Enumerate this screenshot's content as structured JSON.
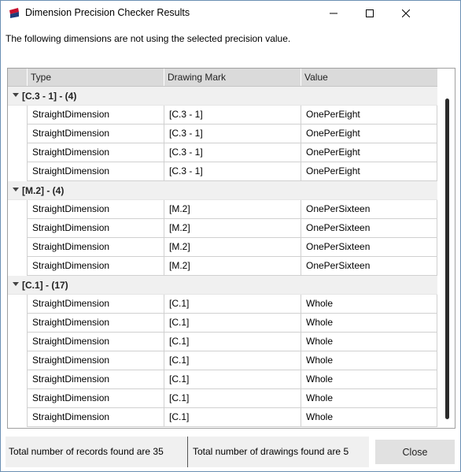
{
  "window": {
    "title": "Dimension Precision Checker Results"
  },
  "description": "The following dimensions are not using the selected precision value.",
  "grid": {
    "columns": [
      "Type",
      "Drawing Mark",
      "Value"
    ],
    "groups": [
      {
        "label": "[C.3 - 1] - (4)",
        "rows": [
          [
            "StraightDimension",
            "[C.3 - 1]",
            "OnePerEight"
          ],
          [
            "StraightDimension",
            "[C.3 - 1]",
            "OnePerEight"
          ],
          [
            "StraightDimension",
            "[C.3 - 1]",
            "OnePerEight"
          ],
          [
            "StraightDimension",
            "[C.3 - 1]",
            "OnePerEight"
          ]
        ]
      },
      {
        "label": "[M.2] - (4)",
        "rows": [
          [
            "StraightDimension",
            "[M.2]",
            "OnePerSixteen"
          ],
          [
            "StraightDimension",
            "[M.2]",
            "OnePerSixteen"
          ],
          [
            "StraightDimension",
            "[M.2]",
            "OnePerSixteen"
          ],
          [
            "StraightDimension",
            "[M.2]",
            "OnePerSixteen"
          ]
        ]
      },
      {
        "label": "[C.1] - (17)",
        "rows": [
          [
            "StraightDimension",
            "[C.1]",
            "Whole"
          ],
          [
            "StraightDimension",
            "[C.1]",
            "Whole"
          ],
          [
            "StraightDimension",
            "[C.1]",
            "Whole"
          ],
          [
            "StraightDimension",
            "[C.1]",
            "Whole"
          ],
          [
            "StraightDimension",
            "[C.1]",
            "Whole"
          ],
          [
            "StraightDimension",
            "[C.1]",
            "Whole"
          ],
          [
            "StraightDimension",
            "[C.1]",
            "Whole"
          ]
        ]
      }
    ]
  },
  "footer": {
    "total_records": "Total number of records found are 35",
    "total_drawings": "Total number of drawings found are 5",
    "close_label": "Close"
  },
  "colors": {
    "accent": "#c8102e",
    "header_bg": "#dadada",
    "group_bg": "#f0f0f0"
  },
  "icons": [
    "app-icon",
    "minimize-icon",
    "maximize-icon",
    "close-icon",
    "chevron-down-icon"
  ]
}
